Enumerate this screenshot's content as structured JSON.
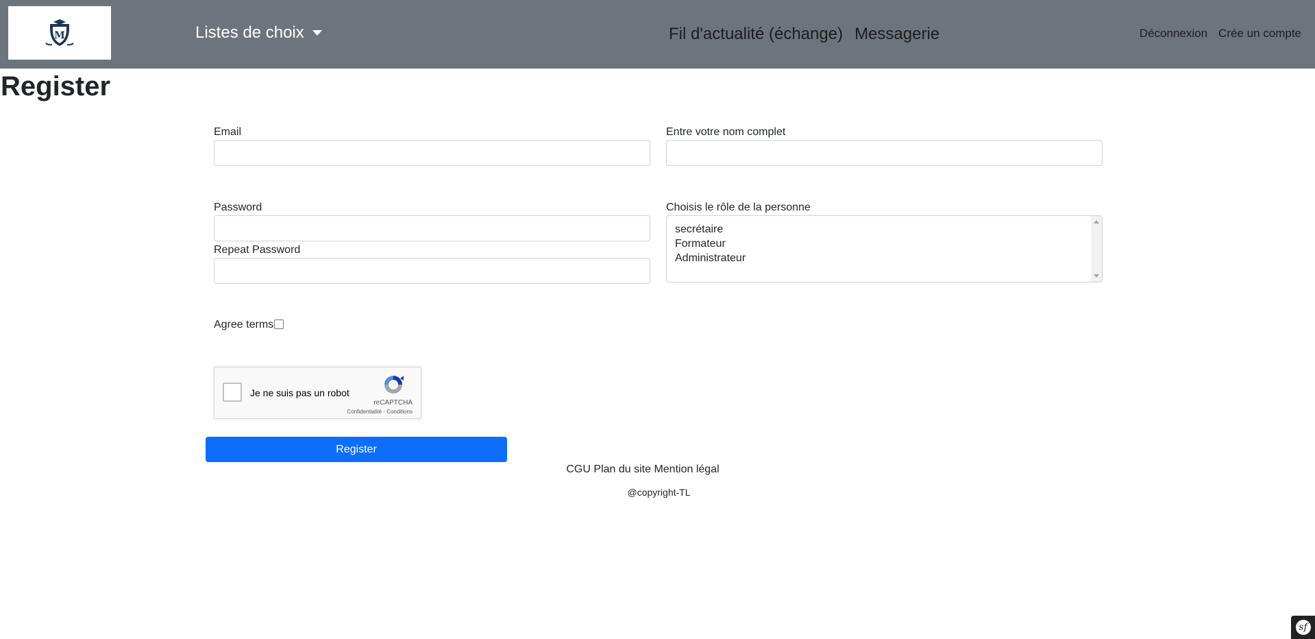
{
  "navbar": {
    "logo_icon": "school-crest-logo",
    "dropdown_label": "Listes de choix",
    "center_links": [
      "Fil d'actualité (échange)",
      "Messagerie"
    ],
    "right_links": [
      "Déconnexion",
      "Crée un compte"
    ],
    "background_color": "#6c757d"
  },
  "page": {
    "title": "Register"
  },
  "form": {
    "email_label": "Email",
    "fullname_label": "Entre votre nom complet",
    "password_label": "Password",
    "repeat_password_label": "Repeat Password",
    "role_label": "Choisis le rôle de la personne",
    "role_options": [
      "secrétaire",
      "Formateur",
      "Administrateur"
    ],
    "agree_label": "Agree terms",
    "submit_label": "Register",
    "submit_color": "#0d6efd"
  },
  "captcha": {
    "label": "Je ne suis pas un robot",
    "brand": "reCAPTCHA",
    "privacy": "Confidentialité",
    "separator": " - ",
    "terms": "Conditions"
  },
  "footer": {
    "links": [
      "CGU",
      "Plan du site",
      "Mention légal"
    ],
    "copyright": "@copyright-TL"
  },
  "debug_toolbar": {
    "icon": "symfony-icon",
    "glyph": "sf"
  }
}
